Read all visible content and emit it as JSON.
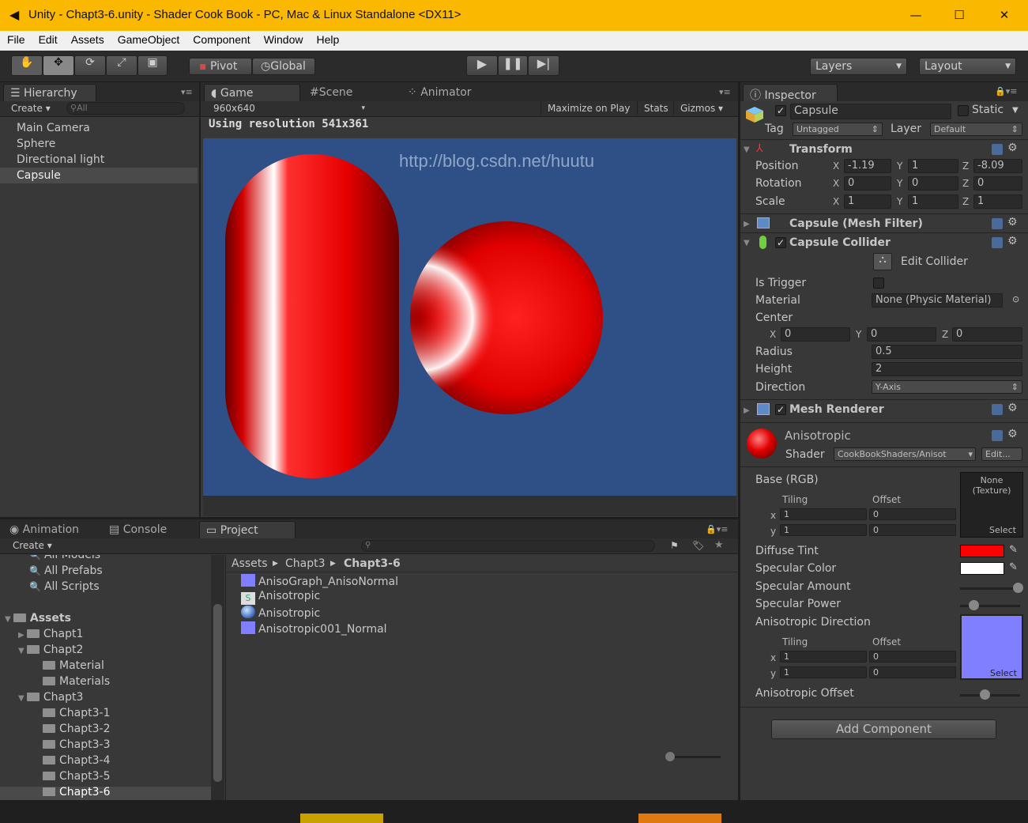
{
  "window": {
    "title": "Unity - Chapt3-6.unity - Shader Cook Book - PC, Mac & Linux Standalone <DX11>",
    "minimize": "—",
    "maximize": "☐",
    "close": "✕"
  },
  "menu": [
    "File",
    "Edit",
    "Assets",
    "GameObject",
    "Component",
    "Window",
    "Help"
  ],
  "toolbar": {
    "pivot": "Pivot",
    "global": "Global",
    "layers": "Layers",
    "layout": "Layout"
  },
  "hierarchy": {
    "tab": "Hierarchy",
    "create": "Create",
    "search": "All",
    "items": [
      "Main Camera",
      "Sphere",
      "Directional light",
      "Capsule"
    ],
    "selected": "Capsule"
  },
  "game": {
    "tabs": [
      "Game",
      "Scene",
      "Animator"
    ],
    "resolution": "960x640",
    "maximize": "Maximize on Play",
    "stats": "Stats",
    "gizmos": "Gizmos",
    "using": "Using resolution 541x361",
    "watermark": "http://blog.csdn.net/huutu",
    "bg": "#2f5086"
  },
  "inspector": {
    "tab": "Inspector",
    "name": "Capsule",
    "static": "Static",
    "tag_label": "Tag",
    "tag": "Untagged",
    "layer_label": "Layer",
    "layer": "Default",
    "transform": {
      "title": "Transform",
      "position": {
        "label": "Position",
        "x": "-1.19",
        "y": "1",
        "z": "-8.09"
      },
      "rotation": {
        "label": "Rotation",
        "x": "0",
        "y": "0",
        "z": "0"
      },
      "scale": {
        "label": "Scale",
        "x": "1",
        "y": "1",
        "z": "1"
      }
    },
    "mesh_filter": "Capsule (Mesh Filter)",
    "collider": {
      "title": "Capsule Collider",
      "edit": "Edit Collider",
      "is_trigger": "Is Trigger",
      "material_label": "Material",
      "material": "None (Physic Material)",
      "center": "Center",
      "cx": "0",
      "cy": "0",
      "cz": "0",
      "radius_label": "Radius",
      "radius": "0.5",
      "height_label": "Height",
      "height": "2",
      "direction_label": "Direction",
      "direction": "Y-Axis"
    },
    "mesh_renderer": "Mesh Renderer",
    "material": {
      "name": "Anisotropic",
      "shader_label": "Shader",
      "shader": "CookBookShaders/Anisot",
      "edit": "Edit...",
      "base": "Base (RGB)",
      "tiling": "Tiling",
      "offset": "Offset",
      "tile_x": "1",
      "tile_y": "1",
      "off_x": "0",
      "off_y": "0",
      "none_tex": "None",
      "tex_type": "(Texture)",
      "select": "Select",
      "diffuse": "Diffuse Tint",
      "diffuse_color": "#ff0000",
      "specular_color": "Specular Color",
      "spec_color": "#ffffff",
      "specular_amount": "Specular Amount",
      "specular_amount_value": 1.0,
      "specular_power": "Specular Power",
      "specular_power_value": 0.2,
      "aniso_dir": "Anisotropic Direction",
      "aniso_tile_x": "1",
      "aniso_tile_y": "1",
      "aniso_off_x": "0",
      "aniso_off_y": "0",
      "aniso_tex_color": "#7f7fff",
      "aniso_offset": "Anisotropic Offset",
      "aniso_offset_value": 0.4
    },
    "add_component": "Add Component"
  },
  "bottom": {
    "tabs": [
      "Animation",
      "Console",
      "Project"
    ],
    "create": "Create",
    "favorites": [
      "All Models",
      "All Prefabs",
      "All Scripts"
    ],
    "tree": [
      {
        "label": "Assets",
        "depth": 0,
        "open": true,
        "bold": true
      },
      {
        "label": "Chapt1",
        "depth": 1,
        "open": false
      },
      {
        "label": "Chapt2",
        "depth": 1,
        "open": true
      },
      {
        "label": "Material",
        "depth": 2
      },
      {
        "label": "Materials",
        "depth": 2
      },
      {
        "label": "Chapt3",
        "depth": 1,
        "open": true
      },
      {
        "label": "Chapt3-1",
        "depth": 2
      },
      {
        "label": "Chapt3-2",
        "depth": 2
      },
      {
        "label": "Chapt3-3",
        "depth": 2
      },
      {
        "label": "Chapt3-4",
        "depth": 2
      },
      {
        "label": "Chapt3-5",
        "depth": 2
      },
      {
        "label": "Chapt3-6",
        "depth": 2,
        "selected": true
      }
    ],
    "breadcrumb": [
      "Assets",
      "Chapt3",
      "Chapt3-6"
    ],
    "files": [
      {
        "name": "AnisoGraph_AnisoNormal",
        "icon": "texture"
      },
      {
        "name": "Anisotropic",
        "icon": "shader"
      },
      {
        "name": "Anisotropic",
        "icon": "material"
      },
      {
        "name": "Anisotropic001_Normal",
        "icon": "texture"
      }
    ]
  }
}
